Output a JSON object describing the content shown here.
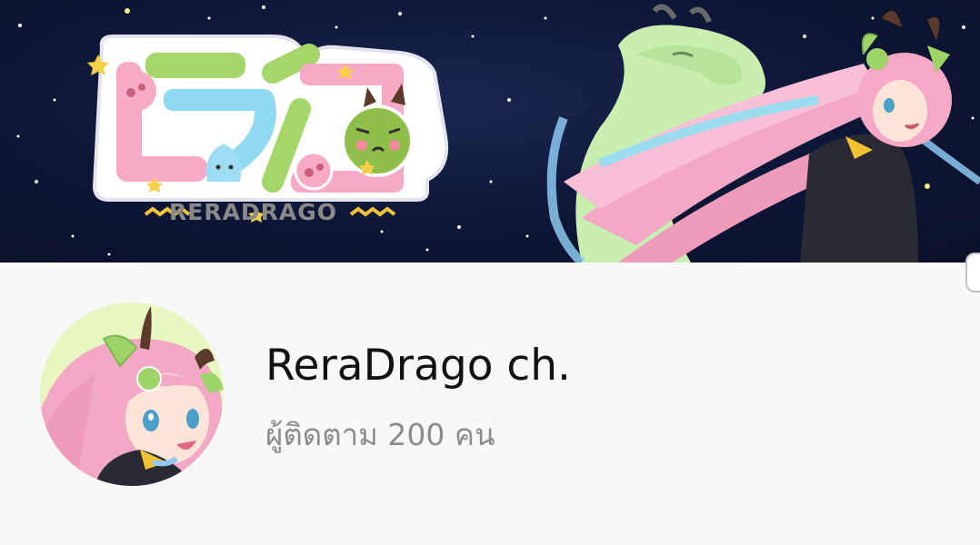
{
  "banner": {
    "logo_text": "RERADRAGO",
    "image": "channel-banner-art"
  },
  "channel": {
    "name": "ReraDrago ch.",
    "subscribers": "ผู้ติดตาม 200 คน",
    "avatar": "channel-avatar-art"
  },
  "colors": {
    "banner_background": "#0e1636",
    "page_background": "#f8f8f8",
    "title": "#111111",
    "subtitle": "#8c8c8c"
  }
}
